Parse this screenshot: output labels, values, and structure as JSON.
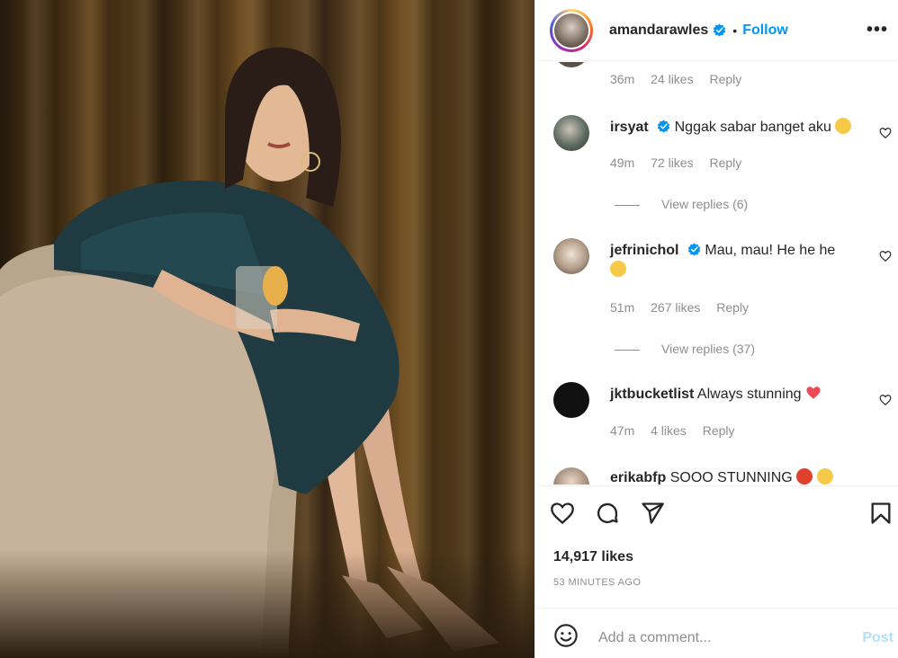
{
  "post": {
    "username": "amandarawles",
    "follow_label": "Follow",
    "dot": "•",
    "more": "•••"
  },
  "comments": {
    "top_meta": {
      "time": "36m",
      "likes": "24 likes",
      "reply": "Reply"
    },
    "items": [
      {
        "user": "irsyat",
        "verified": true,
        "text": "Nggak sabar banget aku",
        "time": "49m",
        "likes": "72 likes",
        "reply": "Reply",
        "view_replies": "View replies (6)"
      },
      {
        "user": "jefrinichol",
        "verified": true,
        "text": "Mau, mau! He he he",
        "time": "51m",
        "likes": "267 likes",
        "reply": "Reply",
        "view_replies": "View replies (37)"
      },
      {
        "user": "jktbucketlist",
        "verified": false,
        "text": "Always stunning",
        "time": "47m",
        "likes": "4 likes",
        "reply": "Reply"
      },
      {
        "user": "erikabfp",
        "verified": false,
        "text": "SOOO STUNNING"
      }
    ]
  },
  "actions": {
    "likes": "14,917 likes",
    "time_ago": "53 MINUTES AGO"
  },
  "add_comment": {
    "placeholder": "Add a comment...",
    "post_label": "Post"
  },
  "colors": {
    "link": "#0095f6",
    "muted": "#8e8e8e",
    "heart": "#ed4956"
  }
}
